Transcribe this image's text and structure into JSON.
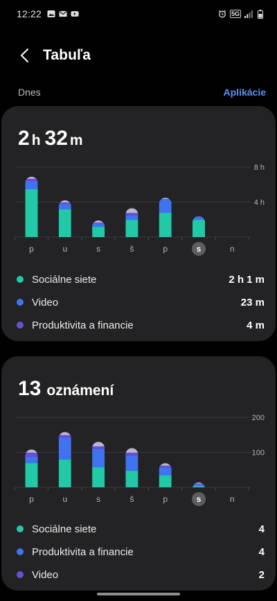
{
  "status_bar": {
    "time": "12:22",
    "network": "5G"
  },
  "header": {
    "title": "Tabuľa"
  },
  "period": {
    "label": "Dnes",
    "apps_link": "Aplikácie"
  },
  "colors": {
    "background": "#010101",
    "card": "#232325",
    "social": "#21c9a6",
    "video": "#3f73f0",
    "productivity": "#6a4fd6",
    "other": "#b9b6cf",
    "accent": "#5b8ff5"
  },
  "usage_card": {
    "hours": "2",
    "hours_unit": "h",
    "minutes": "32",
    "minutes_unit": "m",
    "legend": [
      {
        "name": "Sociálne siete",
        "value": "2 h 1 m",
        "color_key": "social"
      },
      {
        "name": "Video",
        "value": "23 m",
        "color_key": "video"
      },
      {
        "name": "Produktivita a financie",
        "value": "4 m",
        "color_key": "productivity"
      }
    ]
  },
  "notifications_card": {
    "count": "13",
    "label": "oznámení",
    "legend": [
      {
        "name": "Sociálne siete",
        "value": "4",
        "color_key": "social"
      },
      {
        "name": "Produktivita a financie",
        "value": "4",
        "color_key": "video"
      },
      {
        "name": "Video",
        "value": "2",
        "color_key": "productivity"
      }
    ]
  },
  "chart_data": [
    {
      "type": "bar",
      "stacked": true,
      "categories": [
        "p",
        "u",
        "s",
        "š",
        "p",
        "s",
        "n"
      ],
      "selected_index": 5,
      "ylim": [
        0,
        8
      ],
      "yticks": [
        {
          "value": 8,
          "label": "8 h"
        },
        {
          "value": 4,
          "label": "4 h"
        }
      ],
      "series": [
        {
          "color_key": "social",
          "values": [
            5.5,
            3.2,
            1.2,
            2.0,
            2.8,
            2.0,
            0
          ]
        },
        {
          "color_key": "video",
          "values": [
            0.9,
            0.6,
            0.4,
            0.5,
            1.6,
            0.3,
            0
          ]
        },
        {
          "color_key": "productivity",
          "values": [
            0.3,
            0.2,
            0.1,
            0.3,
            0,
            0.1,
            0
          ]
        },
        {
          "color_key": "other",
          "values": [
            0.2,
            0.2,
            0.2,
            0.5,
            0.1,
            0,
            0
          ]
        }
      ]
    },
    {
      "type": "bar",
      "stacked": true,
      "categories": [
        "p",
        "u",
        "s",
        "š",
        "p",
        "s",
        "n"
      ],
      "selected_index": 5,
      "ylim": [
        0,
        200
      ],
      "yticks": [
        {
          "value": 200,
          "label": "200"
        },
        {
          "value": 100,
          "label": "100"
        }
      ],
      "series": [
        {
          "color_key": "social",
          "values": [
            70,
            80,
            58,
            48,
            35,
            4,
            0
          ]
        },
        {
          "color_key": "video",
          "values": [
            18,
            62,
            52,
            42,
            22,
            6,
            0
          ]
        },
        {
          "color_key": "productivity",
          "values": [
            12,
            8,
            8,
            10,
            6,
            2,
            0
          ]
        },
        {
          "color_key": "other",
          "values": [
            8,
            8,
            12,
            12,
            6,
            2,
            0
          ]
        }
      ]
    }
  ]
}
